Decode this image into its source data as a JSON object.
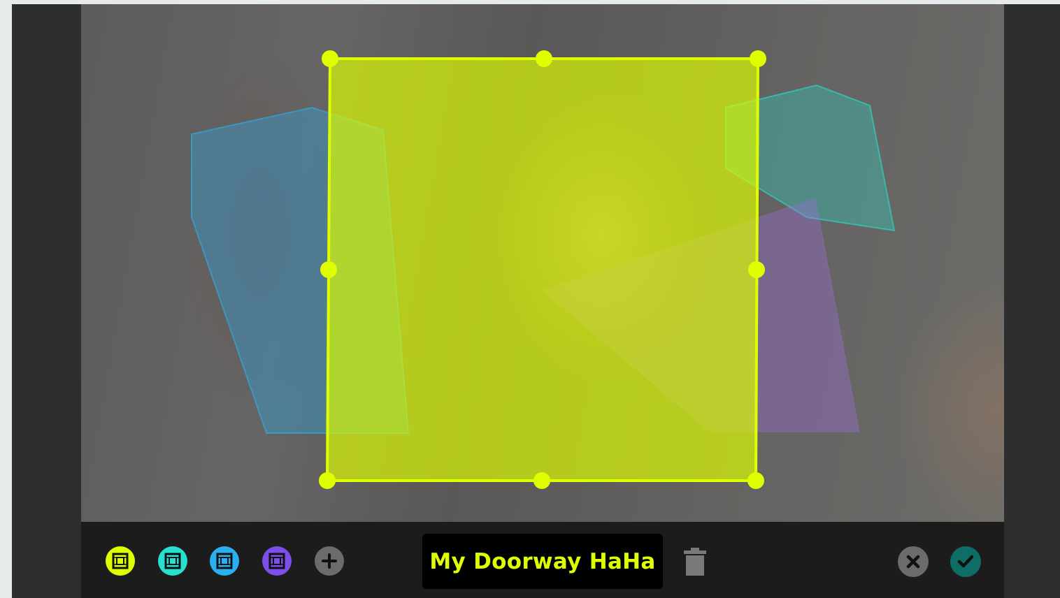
{
  "zone": {
    "name": "My Doorway HaHa",
    "color": "#dfff00"
  },
  "colors": {
    "yellow_zone": "#dfff00",
    "cyan_zone": "#28e0cf",
    "blue_zone": "#2ab0f0",
    "purple_zone": "#7d4ee8",
    "add_button": "#6b6b6b",
    "cancel_button": "#6b6b6b",
    "confirm_button": "#0e6e66",
    "toolbar_background": "#1c1c1c",
    "frame_background": "#2d2e30"
  },
  "icons": {
    "yellow_zone": "zone-select-icon",
    "cyan_zone": "zone-select-icon",
    "blue_zone": "zone-select-icon",
    "purple_zone": "zone-select-icon",
    "add": "plus-icon",
    "delete": "trash-icon",
    "cancel": "close-icon",
    "confirm": "check-icon"
  }
}
